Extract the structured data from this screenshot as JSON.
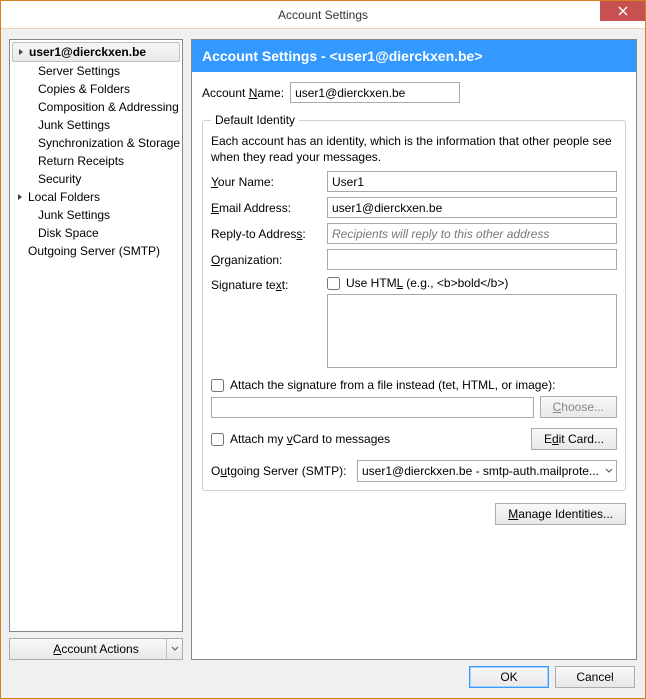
{
  "window": {
    "title": "Account Settings"
  },
  "sidebar": {
    "items": [
      {
        "label": "user1@dierckxen.be",
        "bold": true,
        "expandable": true,
        "selected": true
      },
      {
        "label": "Server Settings",
        "child": true
      },
      {
        "label": "Copies & Folders",
        "child": true
      },
      {
        "label": "Composition & Addressing",
        "child": true
      },
      {
        "label": "Junk Settings",
        "child": true
      },
      {
        "label": "Synchronization & Storage",
        "child": true
      },
      {
        "label": "Return Receipts",
        "child": true
      },
      {
        "label": "Security",
        "child": true
      },
      {
        "label": "Local Folders",
        "expandable": true
      },
      {
        "label": "Junk Settings",
        "child": true
      },
      {
        "label": "Disk Space",
        "child": true
      },
      {
        "label": "Outgoing Server (SMTP)"
      }
    ],
    "account_actions_btn": {
      "pre": "",
      "ul": "A",
      "post": "ccount Actions"
    }
  },
  "content": {
    "header": "Account Settings - <user1@dierckxen.be>",
    "account_name": {
      "label_pre": "Account ",
      "label_ul": "N",
      "label_post": "ame:",
      "value": "user1@dierckxen.be"
    },
    "group_legend": "Default Identity",
    "description": "Each account has an identity, which is the information that other people see when they read your messages.",
    "your_name": {
      "label_pre": "",
      "label_ul": "Y",
      "label_post": "our Name:",
      "value": "User1"
    },
    "email": {
      "label_pre": "",
      "label_ul": "E",
      "label_post": "mail Address:",
      "value": "user1@dierckxen.be"
    },
    "reply_to": {
      "label_pre": "Reply-to Addres",
      "label_ul": "s",
      "label_post": ":",
      "value": "",
      "placeholder": "Recipients will reply to this other address"
    },
    "organization": {
      "label_pre": "",
      "label_ul": "O",
      "label_post": "rganization:",
      "value": ""
    },
    "signature": {
      "label_pre": "Signature te",
      "label_ul": "x",
      "label_post": "t:",
      "use_html_pre": "Use HTM",
      "use_html_ul": "L",
      "use_html_post": " (e.g., <b>bold</b>)",
      "use_html_checked": false,
      "text_value": ""
    },
    "attach_file": {
      "checked": false,
      "pre": "Attach the signature from a file instead (te",
      "ul": "x",
      "post": "t, HTML, or image):",
      "path_value": "",
      "choose_btn_pre": "",
      "choose_btn_ul": "C",
      "choose_btn_post": "hoose..."
    },
    "vcard": {
      "checked": false,
      "pre": "Attach my ",
      "ul": "v",
      "post": "Card to messages",
      "edit_btn_pre": "E",
      "edit_btn_ul": "d",
      "edit_btn_post": "it Card..."
    },
    "smtp": {
      "label_pre": "O",
      "label_ul": "u",
      "label_post": "tgoing Server (SMTP):",
      "selected": "user1@dierckxen.be - smtp-auth.mailprote..."
    },
    "manage_identities_btn": {
      "pre": "",
      "ul": "M",
      "post": "anage Identities..."
    }
  },
  "footer": {
    "ok": "OK",
    "cancel": "Cancel"
  }
}
